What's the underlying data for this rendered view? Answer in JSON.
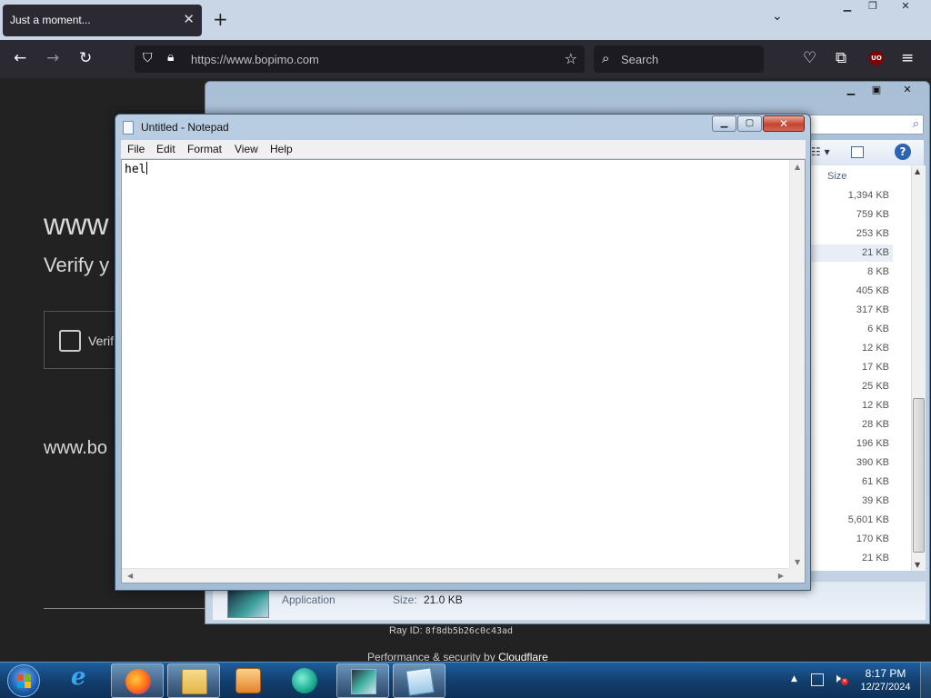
{
  "browser": {
    "tab_title": "Just a moment...",
    "url": "https://www.bopimo.com",
    "search_placeholder": "Search",
    "ublock_badge": "UO"
  },
  "page": {
    "domain_heading": "www",
    "verify_text": "Verify y",
    "checkbox_label": "Verif",
    "waiting_text": "www.bo",
    "ray_label": "Ray ID: ",
    "ray_id": "8f8db5b26c0c43ad",
    "perf_text": "Performance & security by ",
    "perf_brand": "Cloudflare"
  },
  "explorer": {
    "size_header": "Size",
    "sizes": [
      "1,394 KB",
      "759 KB",
      "253 KB",
      "21 KB",
      "8 KB",
      "405 KB",
      "317 KB",
      "6 KB",
      "12 KB",
      "17 KB",
      "25 KB",
      "12 KB",
      "28 KB",
      "196 KB",
      "390 KB",
      "61 KB",
      "39 KB",
      "5,601 KB",
      "170 KB",
      "21 KB"
    ],
    "selected_index": 3,
    "details": {
      "type": "Application",
      "size_label": "Size:",
      "size_value": "21.0 KB"
    }
  },
  "notepad": {
    "title": "Untitled - Notepad",
    "menus": [
      "File",
      "Edit",
      "Format",
      "View",
      "Help"
    ],
    "content": "hel"
  },
  "taskbar": {
    "time": "8:17 PM",
    "date": "12/27/2024",
    "pinned_icons": [
      "internet-explorer-icon",
      "firefox-icon",
      "file-explorer-icon",
      "media-player-icon",
      "chat-app-icon",
      "application-icon",
      "notepad-icon"
    ]
  },
  "colors": {
    "browser_toolbar": "#2b2a33",
    "page_background": "#222222",
    "taskbar": "#123d6b",
    "notepad_close": "#c4432d"
  }
}
